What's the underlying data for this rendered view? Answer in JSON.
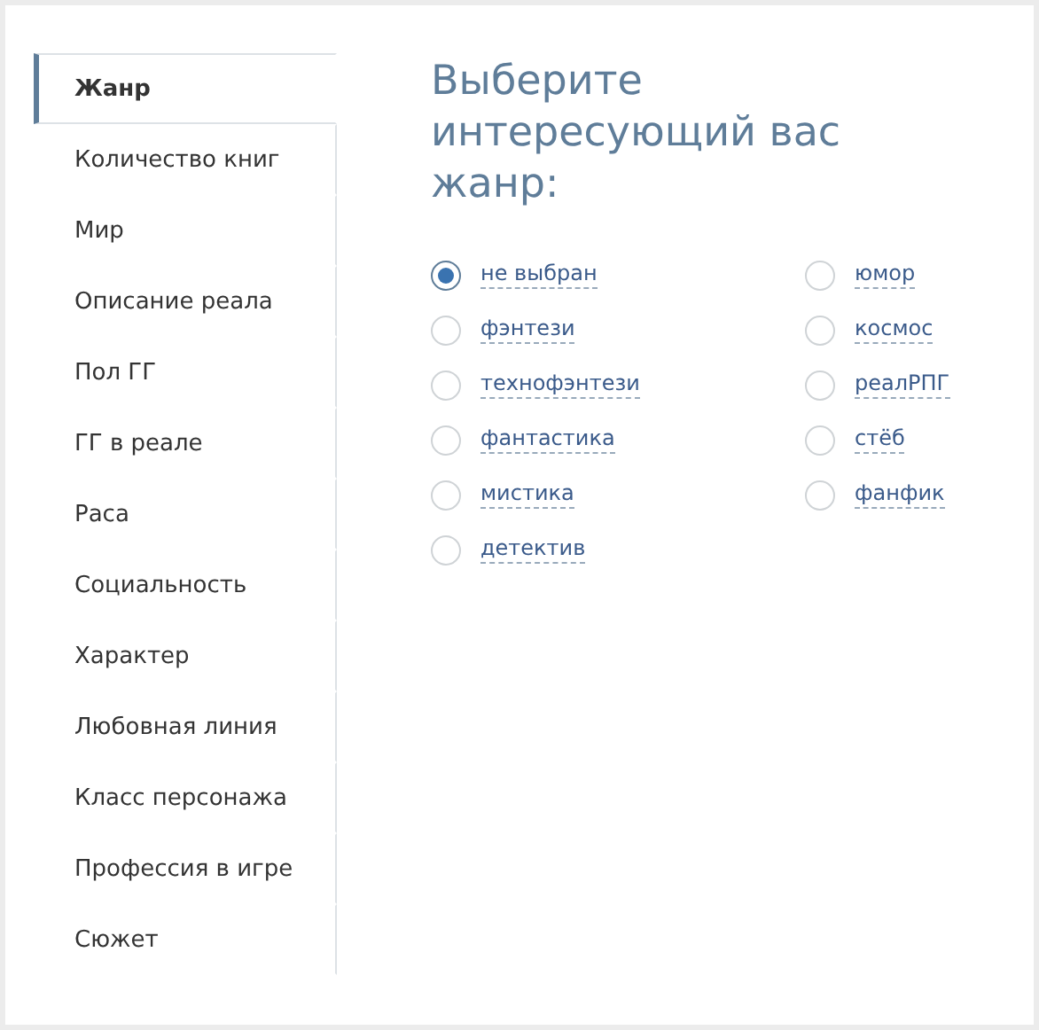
{
  "sidebar": {
    "items": [
      {
        "label": "Жанр",
        "selected": true
      },
      {
        "label": "Количество книг",
        "selected": false
      },
      {
        "label": "Мир",
        "selected": false
      },
      {
        "label": "Описание реала",
        "selected": false
      },
      {
        "label": "Пол ГГ",
        "selected": false
      },
      {
        "label": "ГГ в реале",
        "selected": false
      },
      {
        "label": "Раса",
        "selected": false
      },
      {
        "label": "Социальность",
        "selected": false
      },
      {
        "label": "Характер",
        "selected": false
      },
      {
        "label": "Любовная линия",
        "selected": false
      },
      {
        "label": "Класс персонажа",
        "selected": false
      },
      {
        "label": "Профессия в игре",
        "selected": false
      },
      {
        "label": "Сюжет",
        "selected": false
      }
    ]
  },
  "main": {
    "title": "Выберите интересующий вас жанр:",
    "options": [
      {
        "label": "не выбран",
        "selected": true
      },
      {
        "label": "фэнтези",
        "selected": false
      },
      {
        "label": "технофэнтези",
        "selected": false
      },
      {
        "label": "фантастика",
        "selected": false
      },
      {
        "label": "мистика",
        "selected": false
      },
      {
        "label": "детектив",
        "selected": false
      },
      {
        "label": "юмор",
        "selected": false
      },
      {
        "label": "космос",
        "selected": false
      },
      {
        "label": "реалРПГ",
        "selected": false
      },
      {
        "label": "стёб",
        "selected": false
      },
      {
        "label": "фанфик",
        "selected": false
      }
    ]
  }
}
